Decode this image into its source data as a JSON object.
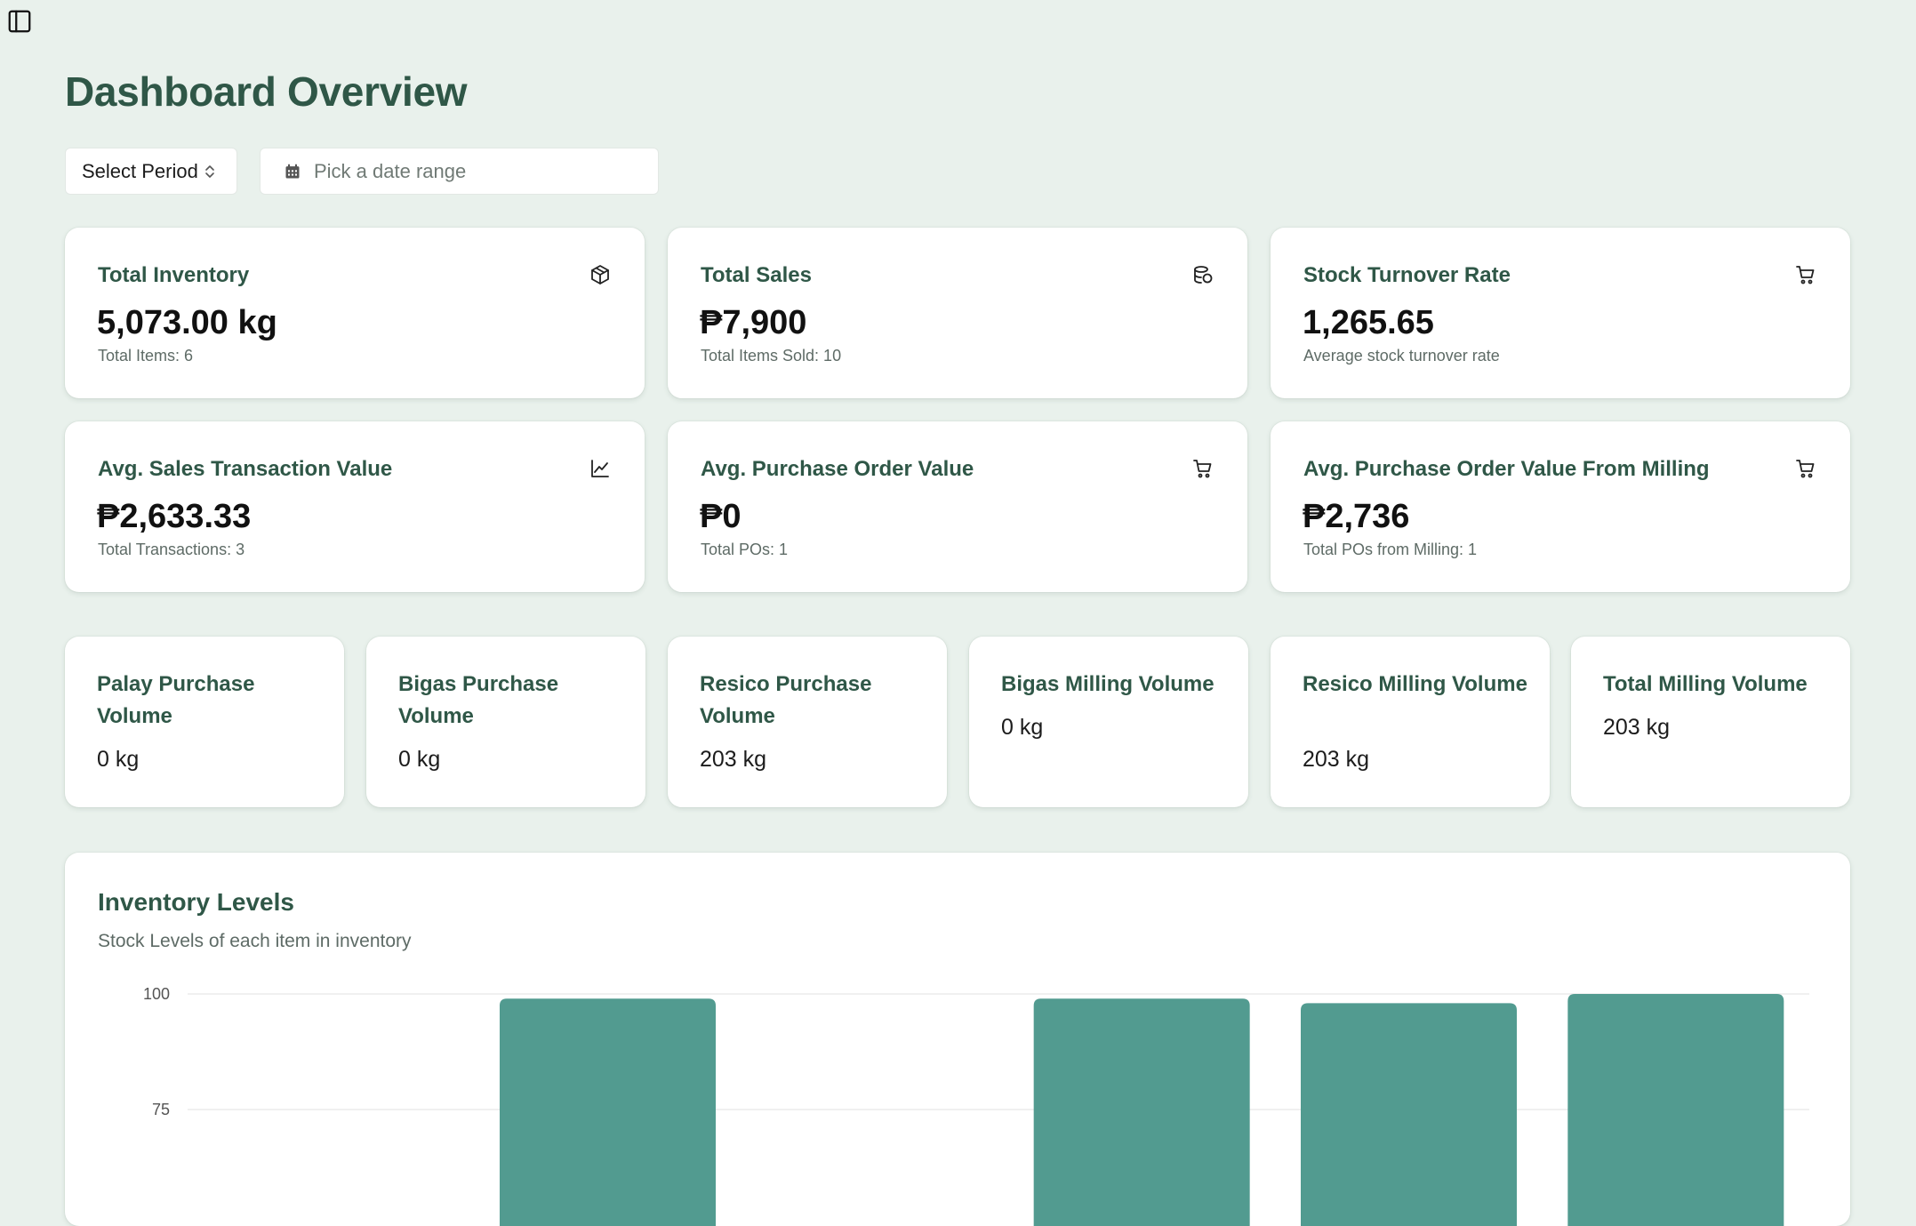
{
  "page": {
    "title": "Dashboard Overview",
    "toggle_icon": "sidebar-toggle-icon"
  },
  "filters": {
    "period_label": "Select Period",
    "date_placeholder": "Pick a date range"
  },
  "stats": [
    {
      "title": "Total Inventory",
      "value": "5,073.00 kg",
      "sub": "Total Items: 6",
      "icon": "package-icon"
    },
    {
      "title": "Total Sales",
      "value": "₱7,900",
      "sub": "Total Items Sold: 10",
      "icon": "coins-icon"
    },
    {
      "title": "Stock Turnover Rate",
      "value": "1,265.65",
      "sub": "Average stock turnover rate",
      "icon": "cart-icon"
    },
    {
      "title": "Avg. Sales Transaction Value",
      "value": "₱2,633.33",
      "sub": "Total Transactions: 3",
      "icon": "line-chart-icon"
    },
    {
      "title": "Avg. Purchase Order Value",
      "value": "₱0",
      "sub": "Total POs: 1",
      "icon": "cart-icon"
    },
    {
      "title": "Avg. Purchase Order Value From Milling",
      "value": "₱2,736",
      "sub": "Total POs from Milling: 1",
      "icon": "cart-icon"
    }
  ],
  "volumes": [
    {
      "title": "Palay Purchase Volume",
      "value": "0 kg"
    },
    {
      "title": "Bigas Purchase Volume",
      "value": "0 kg"
    },
    {
      "title": "Resico Purchase Volume",
      "value": "203 kg"
    },
    {
      "title": "Bigas Milling Volume",
      "value": "0 kg"
    },
    {
      "title": "Resico Milling Volume",
      "value": "203 kg"
    },
    {
      "title": "Total Milling Volume",
      "value": "203 kg"
    }
  ],
  "chart": {
    "title": "Inventory Levels",
    "subtitle": "Stock Levels of each item in inventory"
  },
  "chart_data": {
    "type": "bar",
    "categories": [
      "",
      "",
      "",
      "",
      "",
      ""
    ],
    "values": [
      null,
      99,
      null,
      99,
      98,
      100
    ],
    "yticks": [
      100,
      75
    ],
    "ylim": [
      0,
      100
    ],
    "bar_color": "#529b90",
    "grid": true
  },
  "colors": {
    "background": "#e9f1ec",
    "heading": "#2f5747",
    "bar": "#529b90"
  }
}
